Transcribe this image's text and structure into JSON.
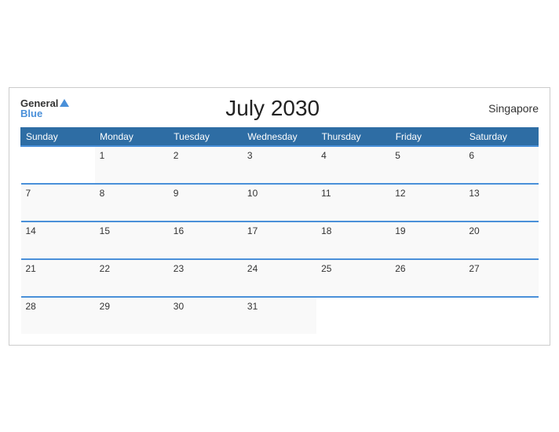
{
  "header": {
    "logo_general": "General",
    "logo_blue": "Blue",
    "title": "July 2030",
    "location": "Singapore"
  },
  "days_of_week": [
    "Sunday",
    "Monday",
    "Tuesday",
    "Wednesday",
    "Thursday",
    "Friday",
    "Saturday"
  ],
  "weeks": [
    [
      "",
      "1",
      "2",
      "3",
      "4",
      "5",
      "6"
    ],
    [
      "7",
      "8",
      "9",
      "10",
      "11",
      "12",
      "13"
    ],
    [
      "14",
      "15",
      "16",
      "17",
      "18",
      "19",
      "20"
    ],
    [
      "21",
      "22",
      "23",
      "24",
      "25",
      "26",
      "27"
    ],
    [
      "28",
      "29",
      "30",
      "31",
      "",
      "",
      ""
    ]
  ]
}
